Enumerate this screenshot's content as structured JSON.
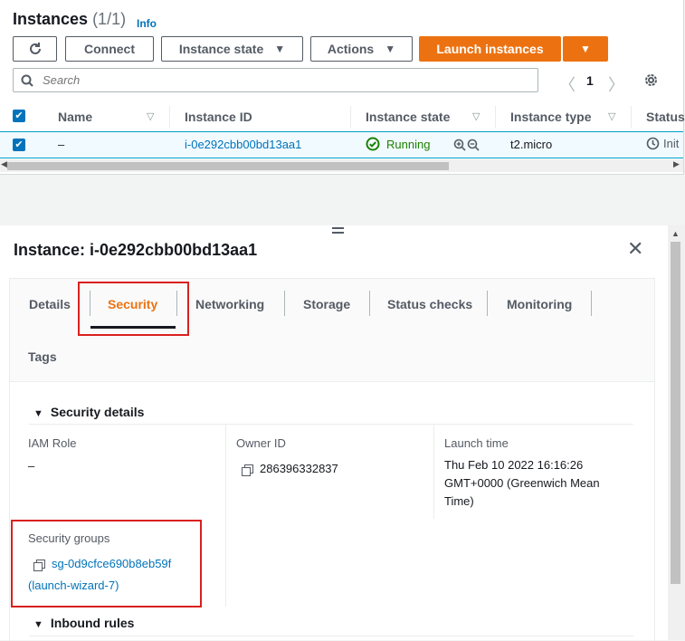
{
  "header": {
    "title": "Instances",
    "count": "(1/1)",
    "info": "Info"
  },
  "toolbar": {
    "connect": "Connect",
    "instance_state": "Instance state",
    "actions": "Actions",
    "launch": "Launch instances"
  },
  "search": {
    "placeholder": "Search"
  },
  "pagination": {
    "page": "1"
  },
  "table": {
    "columns": [
      "Name",
      "Instance ID",
      "Instance state",
      "Instance type",
      "Status"
    ],
    "rows": [
      {
        "name": "–",
        "instance_id": "i-0e292cbb00bd13aa1",
        "state": "Running",
        "type": "t2.micro",
        "status": "Init"
      }
    ]
  },
  "panel": {
    "title": "Instance: i-0e292cbb00bd13aa1",
    "tabs": [
      "Details",
      "Security",
      "Networking",
      "Storage",
      "Status checks",
      "Monitoring",
      "Tags"
    ],
    "active_tab": "Security"
  },
  "security_details": {
    "heading": "Security details",
    "iam_role_label": "IAM Role",
    "iam_role_value": "–",
    "owner_id_label": "Owner ID",
    "owner_id_value": "286396332837",
    "launch_time_label": "Launch time",
    "launch_time_value": "Thu Feb 10 2022 16:16:26 GMT+0000 (Greenwich Mean Time)",
    "security_groups_label": "Security groups",
    "security_group_id": "sg-0d9cfce690b8eb59f",
    "security_group_name": "(launch-wizard-7)"
  },
  "inbound": {
    "heading": "Inbound rules"
  },
  "colors": {
    "accent": "#ec7211",
    "link": "#0073bb",
    "running": "#1d8102",
    "highlight_box": "#d9211f"
  }
}
